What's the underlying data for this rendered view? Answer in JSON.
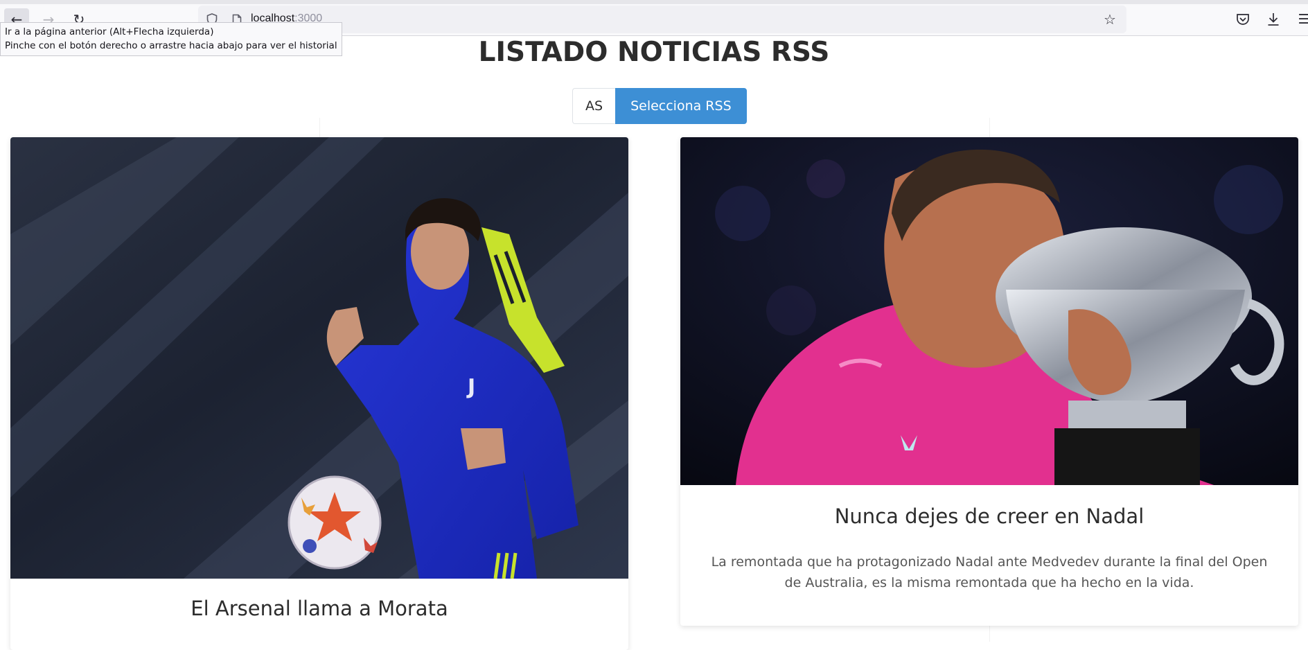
{
  "browser": {
    "url_host": "localhost",
    "url_port": ":3000",
    "tooltip_line1": "Ir a la página anterior (Alt+Flecha izquierda)",
    "tooltip_line2": "Pinche con el botón derecho o arrastre hacia abajo para ver el historial",
    "icons": {
      "back": "arrow-left-icon",
      "forward": "arrow-right-icon",
      "reload": "reload-icon",
      "shield": "shield-icon",
      "page": "page-icon",
      "bookmark": "star-icon",
      "pocket": "pocket-icon",
      "downloads": "download-icon",
      "menu": "menu-icon"
    }
  },
  "page": {
    "title": "LISTADO NOTICIAS RSS",
    "selector": {
      "source_label": "AS",
      "select_label": "Selecciona RSS",
      "accent_color": "#3d8fd5"
    }
  },
  "news": [
    {
      "title": "El Arsenal llama a Morata",
      "image_alt": "Jugador de la Juventus con chándal azul y balón"
    },
    {
      "title": "Nunca dejes de creer en Nadal",
      "description": "La remontada que ha protagonizado Nadal ante Medvedev durante la final del Open de Australia, es la misma remontada que ha hecho en la vida.",
      "image_alt": "Tenista con camiseta rosa besando el trofeo"
    }
  ]
}
